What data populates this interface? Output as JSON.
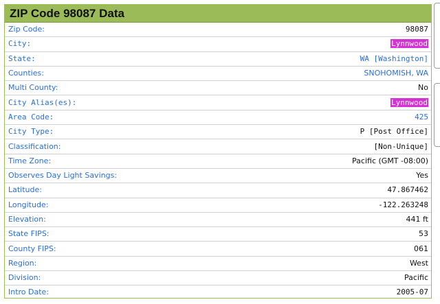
{
  "title": "ZIP Code 98087 Data",
  "rows": [
    {
      "label": "Zip Code:",
      "value": "98087"
    },
    {
      "label": "City:",
      "value": "Lynnwood"
    },
    {
      "label": "State:",
      "value": "WA [Washington]"
    },
    {
      "label": "Counties:",
      "value": "SNOHOMISH, WA"
    },
    {
      "label": "Multi County:",
      "value": "No"
    },
    {
      "label": "City Alias(es):",
      "value": "Lynnwood"
    },
    {
      "label": "Area Code:",
      "value": "425"
    },
    {
      "label": "City Type:",
      "value": "P [Post Office]"
    },
    {
      "label": "Classification:",
      "value": "[Non-Unique]"
    },
    {
      "label": "Time Zone:",
      "value": "Pacific (GMT -08:00)"
    },
    {
      "label": "Observes Day Light Savings:",
      "value": "Yes"
    },
    {
      "label": "Latitude:",
      "value": "47.867462"
    },
    {
      "label": "Longitude:",
      "value": "-122.263248"
    },
    {
      "label": "Elevation:",
      "value": "441 ft"
    },
    {
      "label": "State FIPS:",
      "value": "53"
    },
    {
      "label": "County FIPS:",
      "value": "061"
    },
    {
      "label": "Region:",
      "value": "West"
    },
    {
      "label": "Division:",
      "value": "Pacific"
    },
    {
      "label": "Intro Date:",
      "value": "2005-07"
    }
  ],
  "colors": {
    "header_bg": "#9bbb59",
    "label_text": "#2a6fd6",
    "highlight_bg": "#d531d5"
  }
}
